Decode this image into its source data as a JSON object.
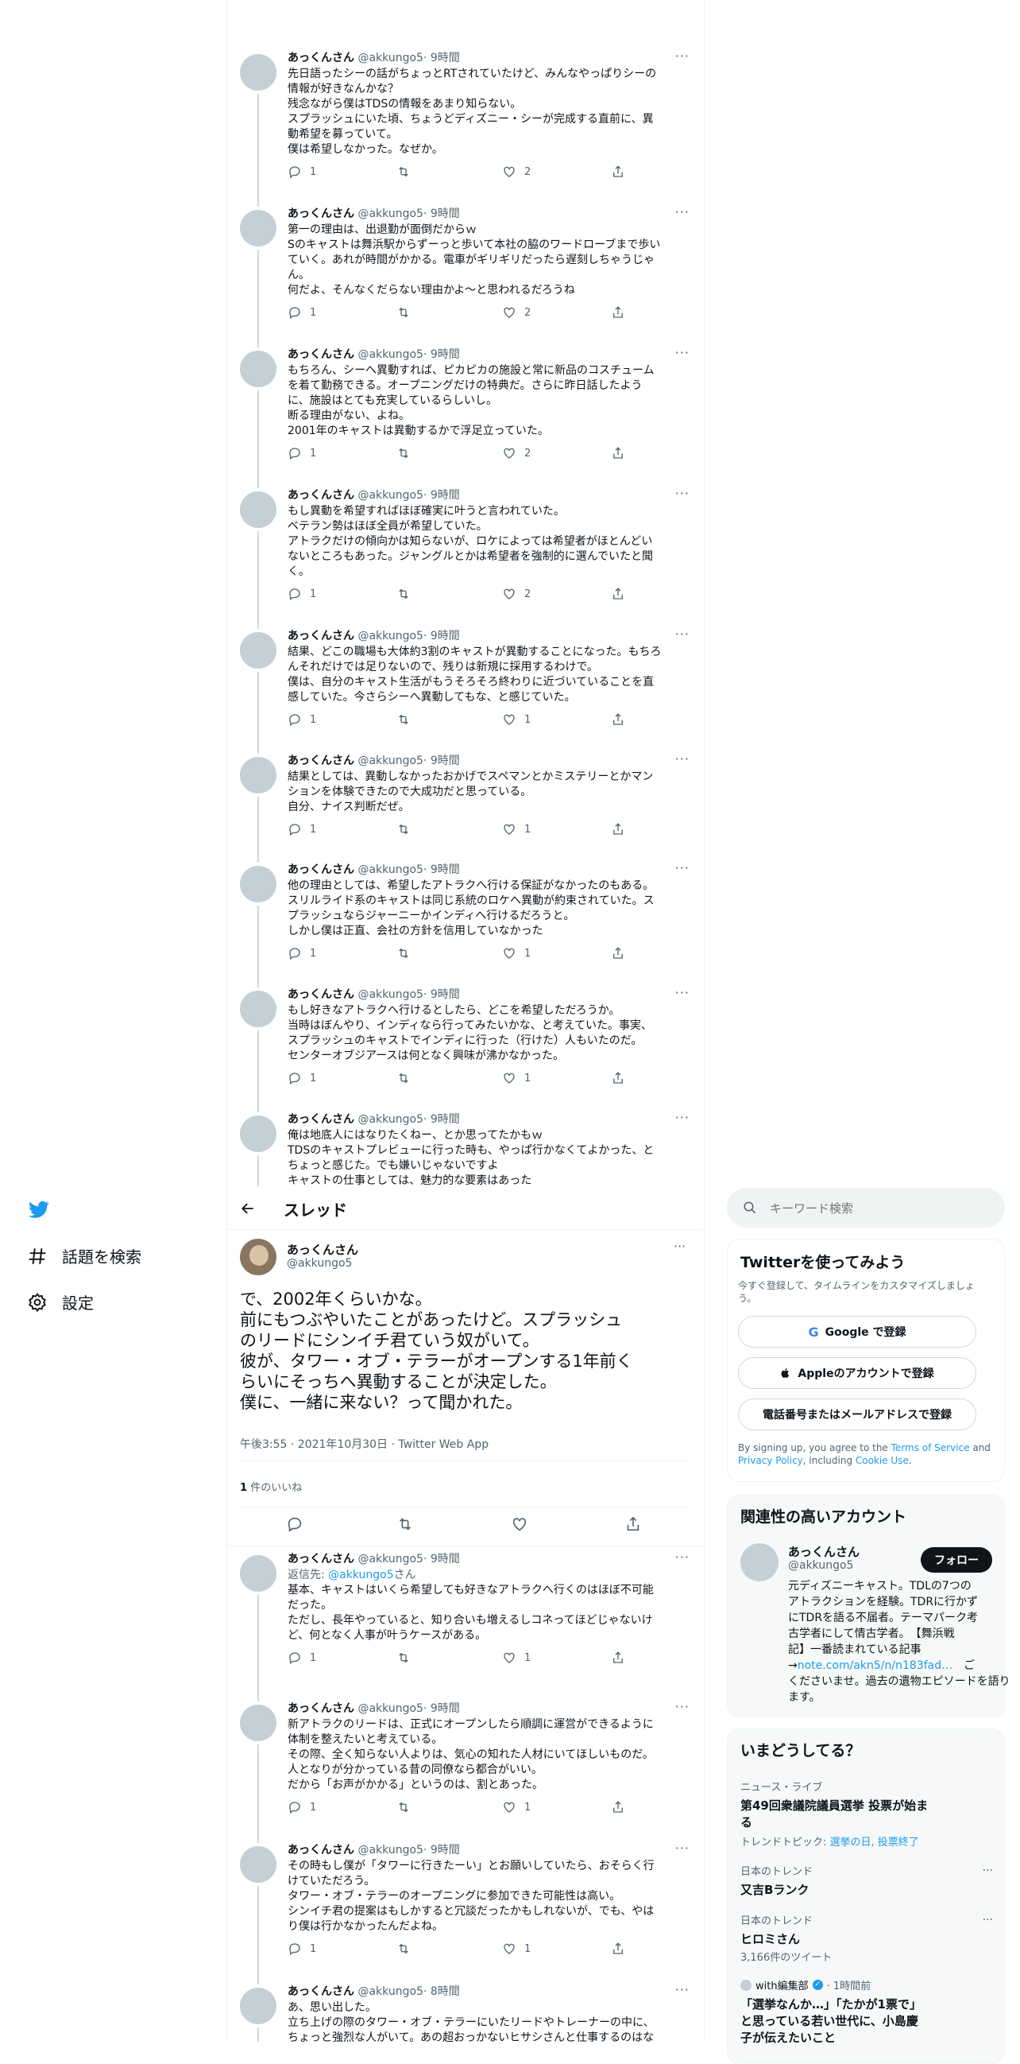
{
  "top_tweets": [
    {
      "name": "あっくんさん",
      "handle": "@akkungo5",
      "time": "· 9時間",
      "lines": [
        "先日語ったシーの話がちょっとRTされていたけど、みんなやっぱりシーの",
        "情報が好きなんかな？",
        "残念ながら僕はTDSの情報をあまり知らない。",
        "スプラッシュにいた頃、ちょうどディズニー・シーが完成する直前に、異",
        "動希望を募っていて。",
        "僕は希望しなかった。なぜか。"
      ],
      "replies": "1",
      "retweets": "",
      "likes": "2"
    },
    {
      "name": "あっくんさん",
      "handle": "@akkungo5",
      "time": "· 9時間",
      "lines": [
        "第一の理由は、出退勤が面倒だからｗ",
        "Sのキャストは舞浜駅からずーっと歩いて本社の脇のワードローブまで歩い",
        "ていく。あれが時間がかかる。電車がギリギリだったら遅刻しちゃうじゃ",
        "ん。",
        "何だよ、そんなくだらない理由かよ〜と思われるだろうね"
      ],
      "replies": "1",
      "retweets": "",
      "likes": "2"
    },
    {
      "name": "あっくんさん",
      "handle": "@akkungo5",
      "time": "· 9時間",
      "lines": [
        "もちろん、シーへ異動すれば、ピカピカの施設と常に新品のコスチューム",
        "を着て勤務できる。オープニングだけの特典だ。さらに昨日話したよう",
        "に、施設はとても充実しているらしいし。",
        "断る理由がない、よね。",
        "2001年のキャストは異動するかで浮足立っていた。"
      ],
      "replies": "1",
      "retweets": "",
      "likes": "2"
    },
    {
      "name": "あっくんさん",
      "handle": "@akkungo5",
      "time": "· 9時間",
      "lines": [
        "もし異動を希望すればほぼ確実に叶うと言われていた。",
        "ベテラン勢はほぼ全員が希望していた。",
        "アトラクだけの傾向かは知らないが、ロケによっては希望者がほとんどい",
        "ないところもあった。ジャングルとかは希望者を強制的に選んでいたと聞",
        "く。"
      ],
      "replies": "1",
      "retweets": "",
      "likes": "2"
    },
    {
      "name": "あっくんさん",
      "handle": "@akkungo5",
      "time": "· 9時間",
      "lines": [
        "結果、どこの職場も大体約3割のキャストが異動することになった。もちろ",
        "んそれだけでは足りないので、残りは新規に採用するわけで。",
        "僕は、自分のキャスト生活がもうそろそろ終わりに近づいていることを直",
        "感していた。今さらシーへ異動してもな、と感じていた。"
      ],
      "replies": "1",
      "retweets": "",
      "likes": "1"
    },
    {
      "name": "あっくんさん",
      "handle": "@akkungo5",
      "time": "· 9時間",
      "lines": [
        "結果としては、異動しなかったおかげでスペマンとかミステリーとかマン",
        "ションを体験できたので大成功だと思っている。",
        "自分、ナイス判断だぜ。"
      ],
      "replies": "1",
      "retweets": "",
      "likes": "1"
    },
    {
      "name": "あっくんさん",
      "handle": "@akkungo5",
      "time": "· 9時間",
      "lines": [
        "他の理由としては、希望したアトラクへ行ける保証がなかったのもある。",
        "スリルライド系のキャストは同じ系統のロケへ異動が約束されていた。ス",
        "プラッシュならジャーニーかインディへ行けるだろうと。",
        "しかし僕は正直、会社の方針を信用していなかった"
      ],
      "replies": "1",
      "retweets": "",
      "likes": "1"
    },
    {
      "name": "あっくんさん",
      "handle": "@akkungo5",
      "time": "· 9時間",
      "lines": [
        "もし好きなアトラクへ行けるとしたら、どこを希望しただろうか。",
        "当時はぼんやり、インディなら行ってみたいかな、と考えていた。事実、",
        "スプラッシュのキャストでインディに行った（行けた）人もいたのだ。",
        "センターオブジアースは何となく興味が沸かなかった。"
      ],
      "replies": "1",
      "retweets": "",
      "likes": "1"
    },
    {
      "name": "あっくんさん",
      "handle": "@akkungo5",
      "time": "· 9時間",
      "lines": [
        "俺は地底人にはなりたくねー、とか思ってたかもｗ",
        "TDSのキャストプレビューに行った時も、やっぱ行かなくてよかった、と",
        "ちょっと感じた。でも嫌いじゃないですよ",
        "キャストの仕事としては、魅力的な要素はあった"
      ],
      "replies": "",
      "retweets": "",
      "likes": ""
    }
  ],
  "nav": {
    "search_label": "話題を検索",
    "settings_label": "設定"
  },
  "header": {
    "title": "スレッド"
  },
  "main_tweet": {
    "name": "あっくんさん",
    "handle": "@akkungo5",
    "lines": [
      "で、2002年くらいかな。",
      "前にもつぶやいたことがあったけど。スプラッシュ",
      "のリードにシンイチ君ていう奴がいて。",
      "彼が、タワー・オブ・テラーがオープンする1年前く",
      "らいにそっちへ異動することが決定した。",
      "僕に、一緒に来ない？って聞かれた。"
    ],
    "meta": "午後3:55 · 2021年10月30日 · Twitter Web App",
    "likes_count": "1",
    "likes_label": "件のいいね"
  },
  "bottom_tweets": [
    {
      "name": "あっくんさん",
      "handle": "@akkungo5",
      "time": "· 9時間",
      "reply_prefix": "返信先: ",
      "reply_handle": "@akkungo5",
      "reply_suffix": "さん",
      "lines": [
        "基本、キャストはいくら希望しても好きなアトラクへ行くのはほぼ不可能",
        "だった。",
        "ただし、長年やっていると、知り合いも増えるしコネってほどじゃないけ",
        "ど、何となく人事が叶うケースがある。"
      ],
      "replies": "1",
      "retweets": "",
      "likes": "1"
    },
    {
      "name": "あっくんさん",
      "handle": "@akkungo5",
      "time": "· 9時間",
      "lines": [
        "新アトラクのリードは、正式にオープンしたら順調に運営ができるように",
        "体制を整えたいと考えている。",
        "その際、全く知らない人よりは、気心の知れた人材にいてほしいものだ。",
        "人となりが分かっている昔の同僚なら都合がいい。",
        "だから「お声がかかる」というのは、割とあった。"
      ],
      "replies": "1",
      "retweets": "",
      "likes": "1"
    },
    {
      "name": "あっくんさん",
      "handle": "@akkungo5",
      "time": "· 9時間",
      "lines": [
        "その時もし僕が「タワーに行きたーい」とお願いしていたら、おそらく行",
        "けていただろう。",
        "タワー・オブ・テラーのオープニングに参加できた可能性は高い。",
        "シンイチ君の提案はもしかすると冗談だったかもしれないが、でも、やは",
        "り僕は行かなかったんだよね。"
      ],
      "replies": "1",
      "retweets": "",
      "likes": "1"
    },
    {
      "name": "あっくんさん",
      "handle": "@akkungo5",
      "time": "· 8時間",
      "lines": [
        "あ、思い出した。",
        "立ち上げの際のタワー・オブ・テラーにいたリードやトレーナーの中に、",
        "ちょっと強烈な人がいて。あの超おっかないヒサシさんと仕事するのはな"
      ],
      "replies": "",
      "retweets": "",
      "likes": ""
    }
  ],
  "search": {
    "placeholder": "キーワード検索"
  },
  "signup": {
    "title": "Twitterを使ってみよう",
    "desc_lines": [
      "今すぐ登録して、タイムラインをカスタマイズしましょ",
      "う。"
    ],
    "google": "Google で登録",
    "apple": "Appleのアカウントで登録",
    "phone": "電話番号またはメールアドレスで登録",
    "terms_1": "By signing up, you agree to the ",
    "terms_link1": "Terms of Service",
    "terms_2": " and",
    "terms_link2": "Privacy Policy",
    "terms_3": ", including ",
    "terms_link3": "Cookie Use",
    "terms_4": "."
  },
  "related": {
    "title": "関連性の高いアカウント",
    "name": "あっくんさん",
    "handle": "@akkungo5",
    "follow": "フォロー",
    "bio_lines": [
      "元ディズニーキャスト。TDLの7つの",
      "アトラクションを経験。TDRに行かず",
      "にTDRを語る不届者。テーマパーク考",
      "古学者にして情古学者。　【舞浜戦",
      "記】一番読まれている記事"
    ],
    "bio_arrow": "→",
    "bio_link": "note.com/akn5/n/n183fad…",
    "bio_after": "　ご",
    "bio_lines2": [
      "くださいませ。過去の遺物エピソードを語り",
      "ます。"
    ]
  },
  "trends": {
    "title": "いまどうしてる？",
    "items": [
      {
        "category": "ニュース・ライブ",
        "title_lines": [
          "第49回衆議院議員選挙 投票が始ま",
          "る"
        ],
        "topic_prefix": "トレンドトピック: ",
        "topic_links": "選挙の日, 投票終了"
      },
      {
        "category": "日本のトレンド",
        "title_lines": [
          "又吉Bランク"
        ]
      },
      {
        "category": "日本のトレンド",
        "title_lines": [
          "ヒロミさん"
        ],
        "count": "3,166件のツイート"
      }
    ],
    "news": {
      "source": "with編集部",
      "time": "· 1時間前",
      "title_lines": [
        "「選挙なんか…」「たかが1票で」",
        "と思っている若い世代に、小島慶",
        "子が伝えたいこと"
      ]
    }
  }
}
